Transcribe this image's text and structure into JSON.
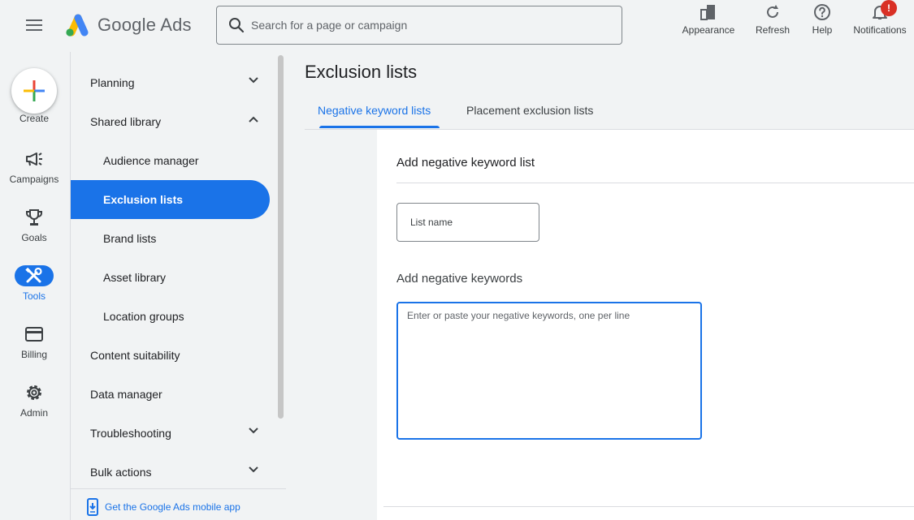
{
  "header": {
    "brand": "Google Ads",
    "search_placeholder": "Search for a page or campaign",
    "tools": [
      {
        "label": "Appearance",
        "icon": "appearance-icon"
      },
      {
        "label": "Refresh",
        "icon": "refresh-icon"
      },
      {
        "label": "Help",
        "icon": "help-icon"
      },
      {
        "label": "Notifications",
        "icon": "bell-icon",
        "badge": "!"
      }
    ]
  },
  "rail": {
    "create_label": "Create",
    "items": [
      {
        "label": "Campaigns",
        "icon": "megaphone-icon"
      },
      {
        "label": "Goals",
        "icon": "trophy-icon"
      },
      {
        "label": "Tools",
        "icon": "tools-icon",
        "active": true
      },
      {
        "label": "Billing",
        "icon": "credit-card-icon"
      },
      {
        "label": "Admin",
        "icon": "gear-icon"
      }
    ]
  },
  "subnav": {
    "items": [
      {
        "label": "Planning",
        "expand": "down"
      },
      {
        "label": "Shared library",
        "expand": "up"
      },
      {
        "label": "Audience manager"
      },
      {
        "label": "Exclusion lists",
        "active": true
      },
      {
        "label": "Brand lists"
      },
      {
        "label": "Asset library"
      },
      {
        "label": "Location groups"
      },
      {
        "label": "Content suitability"
      },
      {
        "label": "Data manager"
      },
      {
        "label": "Troubleshooting",
        "expand": "down"
      },
      {
        "label": "Bulk actions",
        "expand": "down"
      }
    ],
    "mobile_link": "Get the Google Ads mobile app"
  },
  "main": {
    "title": "Exclusion lists",
    "tabs": [
      {
        "label": "Negative keyword lists",
        "active": true
      },
      {
        "label": "Placement exclusion lists"
      }
    ],
    "card": {
      "title": "Add negative keyword list",
      "list_name_placeholder": "List name",
      "keywords_heading": "Add negative keywords",
      "keywords_placeholder": "Enter or paste your negative keywords, one per line"
    }
  },
  "colors": {
    "accent": "#1a73e8",
    "background": "#f1f3f4",
    "badge": "#d93025"
  }
}
